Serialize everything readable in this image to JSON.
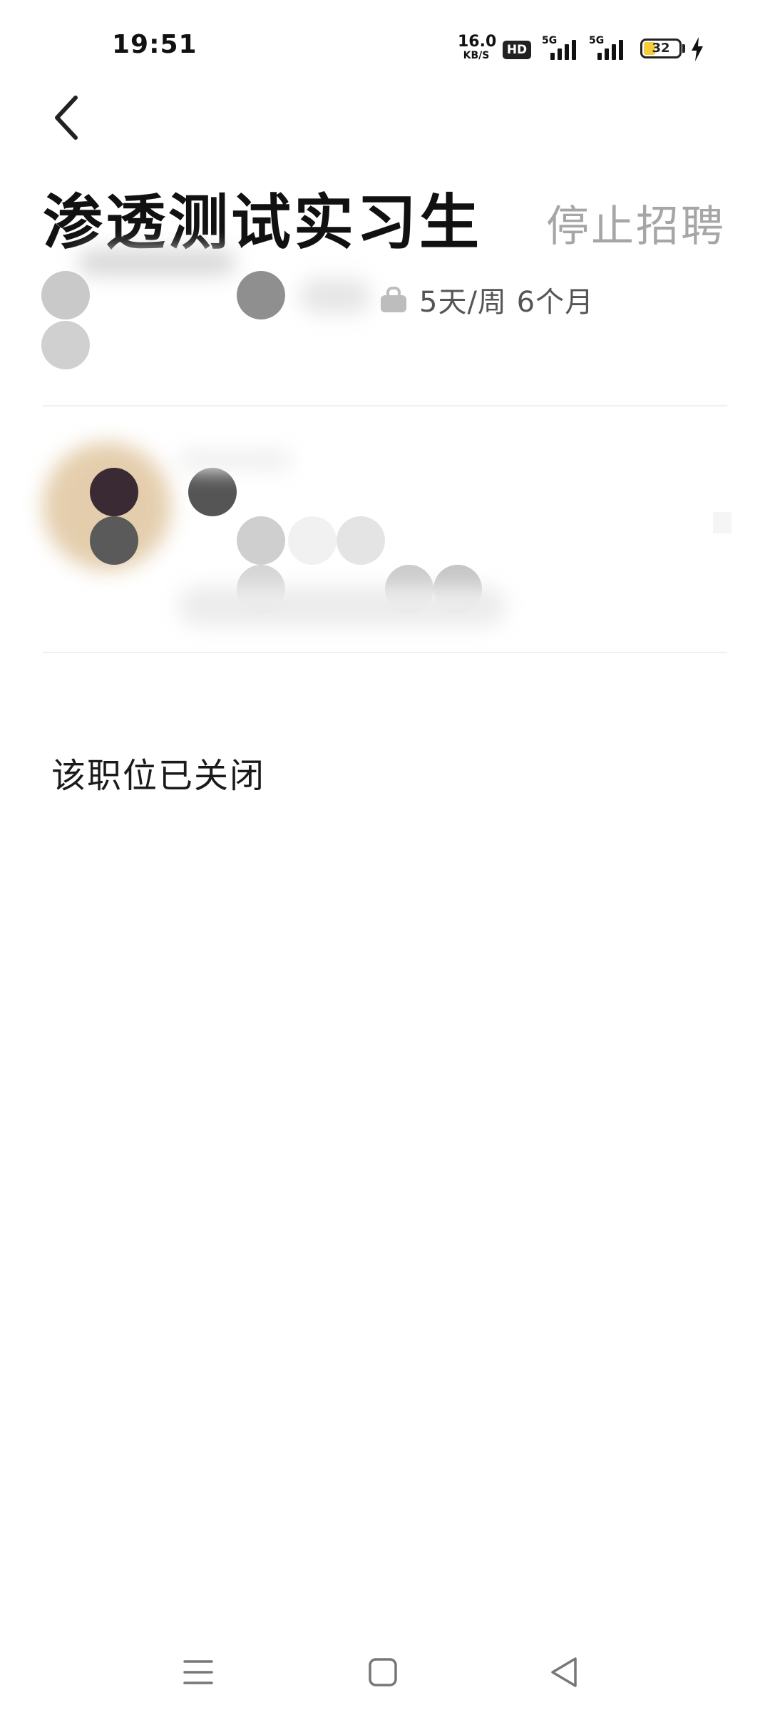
{
  "status_bar": {
    "time": "19:51",
    "net_speed_value": "16.0",
    "net_speed_unit": "KB/S",
    "hd_label": "HD",
    "sim1_type": "5G",
    "sim2_type": "5G",
    "battery_level": "32"
  },
  "header": {
    "back_icon": "chevron-left-icon"
  },
  "job": {
    "title": "渗透测试实习生",
    "stop_recruiting_label": "停止招聘",
    "schedule": "5天/周 6个月",
    "schedule_icon": "briefcase-icon"
  },
  "status": {
    "closed_text": "该职位已关闭"
  },
  "nav_bar": {
    "menu_icon": "menu-icon",
    "home_icon": "home-square-icon",
    "back_icon": "back-triangle-icon"
  },
  "colors": {
    "title": "#111111",
    "muted": "#a6a6a6",
    "divider": "#efefef",
    "battery_fill": "#f5cc3a"
  }
}
